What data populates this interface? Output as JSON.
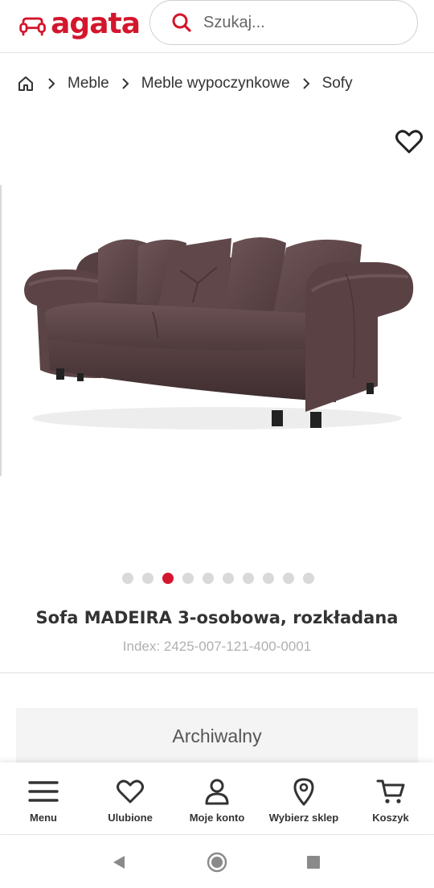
{
  "header": {
    "logo_text": "agata",
    "brand_color": "#d3162c",
    "search": {
      "placeholder": "Szukaj..."
    }
  },
  "breadcrumb": {
    "home_icon": "home-icon",
    "items": [
      "Meble",
      "Meble wypoczynkowe",
      "Sofy"
    ]
  },
  "gallery": {
    "image_subject": "sofa",
    "favorite_icon": "heart-icon",
    "slide_count": 10,
    "active_slide": 3
  },
  "product": {
    "title": "Sofa MADEIRA 3-osobowa, rozkładana",
    "index": "Index: 2425-007-121-400-0001",
    "status": "Archiwalny"
  },
  "bottom_nav": [
    {
      "label": "Menu",
      "icon": "menu-icon"
    },
    {
      "label": "Ulubione",
      "icon": "heart-icon"
    },
    {
      "label": "Moje konto",
      "icon": "user-icon"
    },
    {
      "label": "Wybierz sklep",
      "icon": "location-pin-icon"
    },
    {
      "label": "Koszyk",
      "icon": "cart-icon"
    }
  ],
  "system_bar": [
    "back-icon",
    "home-icon",
    "recent-apps-icon"
  ]
}
